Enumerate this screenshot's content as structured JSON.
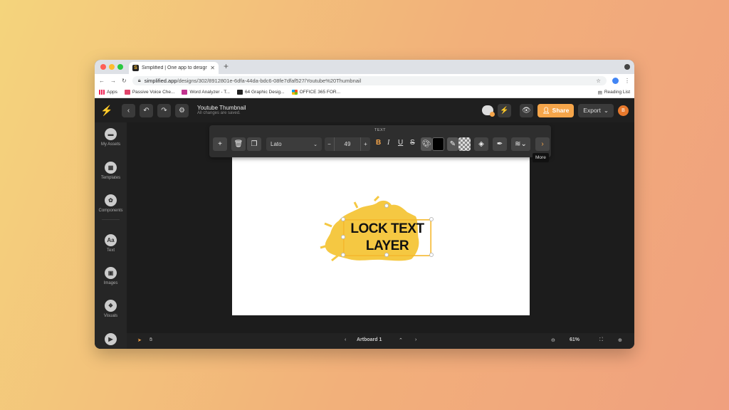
{
  "browser": {
    "tab_title": "Simplified | One app to design",
    "tab_close": "✕",
    "new_tab": "+",
    "url_host": "simplified.app",
    "url_path": "/designs/302/8912801e-6dfa-44da-bdc6-08fe7dfaf527/Youtube%20Thumbnail",
    "bookmarks": [
      "Apps",
      "Passive Voice Che...",
      "Word Analyzer - T...",
      "64 Graphic Desig...",
      "OFFICE 365 FOR..."
    ],
    "reading_list": "Reading List"
  },
  "header": {
    "doc_title": "Youtube Thumbnail",
    "doc_status": "All changes are saved.",
    "share_label": "Share",
    "export_label": "Export",
    "avatar_initial": "B"
  },
  "sidebar": {
    "items": [
      {
        "label": "My Assets",
        "icon": "folder-icon"
      },
      {
        "label": "Templates",
        "icon": "templates-icon"
      },
      {
        "label": "Components",
        "icon": "components-icon"
      },
      {
        "label": "Text",
        "icon": "text-icon"
      },
      {
        "label": "Images",
        "icon": "images-icon"
      },
      {
        "label": "Visuals",
        "icon": "visuals-icon"
      }
    ],
    "text_glyph": "Aa"
  },
  "toolbar": {
    "section_label": "TEXT",
    "font_family": "Lato",
    "font_size": "49",
    "bold": "B",
    "italic": "I",
    "underline": "U",
    "strike": "S",
    "tooltip": "More"
  },
  "canvas": {
    "text_line1": "LOCK TEXT",
    "text_line2": "LAYER"
  },
  "bottombar": {
    "artboard": "Artboard 1",
    "zoom": "61%"
  },
  "colors": {
    "accent": "#f5a54a",
    "brush": "#f5c842",
    "text_color": "#000000"
  }
}
